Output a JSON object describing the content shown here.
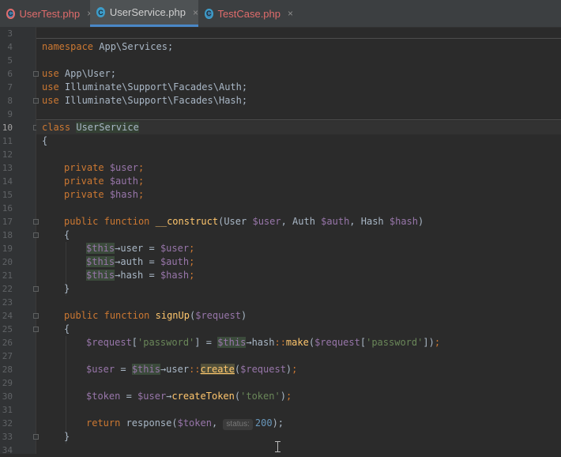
{
  "tabs": [
    {
      "label": "UserTest.php",
      "icon": "php-class-icon",
      "color": "#e06c6c",
      "active": false
    },
    {
      "label": "UserService.php",
      "icon": "php-class-icon",
      "color": "#d0d0d0",
      "active": true
    },
    {
      "label": "TestCase.php",
      "icon": "php-class-icon",
      "color": "#e06c6c",
      "active": false
    }
  ],
  "tab_close": "×",
  "gutter": {
    "line_numbers": [
      "3",
      "4",
      "5",
      "6",
      "7",
      "8",
      "9",
      "10",
      "11",
      "12",
      "13",
      "14",
      "15",
      "16",
      "17",
      "18",
      "19",
      "20",
      "21",
      "22",
      "23",
      "24",
      "25",
      "26",
      "27",
      "28",
      "29",
      "30",
      "31",
      "32",
      "33",
      "34"
    ],
    "current_line": "10"
  },
  "code": {
    "namespace_kw": "namespace",
    "namespace_name": " App\\Services;",
    "use_kw": "use",
    "use1": " App\\User;",
    "use2": " Illuminate\\Support\\Facades\\Auth;",
    "use3": " Illuminate\\Support\\Facades\\Hash;",
    "class_kw": "class",
    "class_name": "UserService",
    "open_brace": "{",
    "close_brace": "}",
    "private_kw": "private",
    "prop_user": "$user",
    "prop_auth": "$auth",
    "prop_hash": "$hash",
    "semicolon": ";",
    "public_kw": "public",
    "function_kw": "function",
    "construct_name": "__construct",
    "construct_params_1": "(User ",
    "construct_params_2": ", Auth ",
    "construct_params_3": ", Hash ",
    "construct_params_4": ")",
    "this": "$this",
    "arrow": "→",
    "assign_user": "user = ",
    "assign_auth": "auth = ",
    "assign_hash": "hash = ",
    "signup_name": "signUp",
    "request_var": "$request",
    "paren_open": "(",
    "paren_close": ")",
    "password_str": "'password'",
    "bracket_open": "[",
    "bracket_close": "]",
    "eq": " = ",
    "hash_prop": "hash",
    "dcolon": "::",
    "make_fn": "make",
    "user_prop": "user",
    "create_fn": "create",
    "token_var": "$token",
    "create_token_fn": "createToken",
    "token_str": "'token'",
    "return_kw": "return",
    "response_fn": " response(",
    "comma": ", ",
    "status_hint": "status:",
    "status_value": "200",
    "end_call": ");"
  }
}
